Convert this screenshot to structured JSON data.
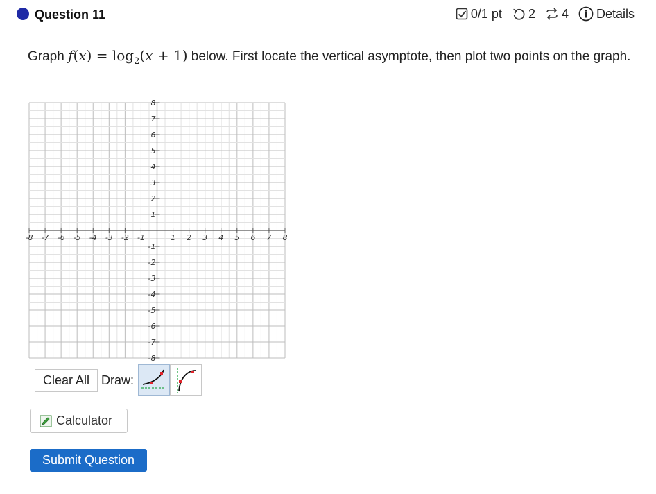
{
  "question": {
    "title": "Question 11"
  },
  "status": {
    "score": "0/1 pt",
    "retries": "2",
    "attempts": "4",
    "details_label": "Details"
  },
  "prompt": {
    "before": "Graph ",
    "func": "f",
    "var": "x",
    "log_base": "2",
    "arg_tail": "+ 1",
    "after": " below. First locate the vertical asymptote, then plot two points on the graph."
  },
  "graph": {
    "x_ticks": [
      "-8",
      "-7",
      "-6",
      "-5",
      "-4",
      "-3",
      "-2",
      "-1",
      "1",
      "2",
      "3",
      "4",
      "5",
      "6",
      "7",
      "8"
    ],
    "y_ticks": [
      "8",
      "7",
      "6",
      "5",
      "4",
      "3",
      "2",
      "1",
      "-1",
      "-2",
      "-3",
      "-4",
      "-5",
      "-6",
      "-7",
      "-8"
    ],
    "x_range": [
      -8,
      8
    ],
    "y_range": [
      -8,
      8
    ],
    "grid_color": "#c8c8c8",
    "axis_color": "#555555"
  },
  "toolbar": {
    "clear_all": "Clear All",
    "draw_label": "Draw:",
    "tools": [
      "log-tool-horizontal-asymptote",
      "log-tool-vertical-asymptote"
    ]
  },
  "calculator": {
    "label": "Calculator"
  },
  "submit": {
    "label": "Submit Question"
  },
  "colors": {
    "accent": "#1b6cc8",
    "dot": "#1f2aa6",
    "marker": "#e0232a",
    "asymptote": "#2aa84a"
  }
}
